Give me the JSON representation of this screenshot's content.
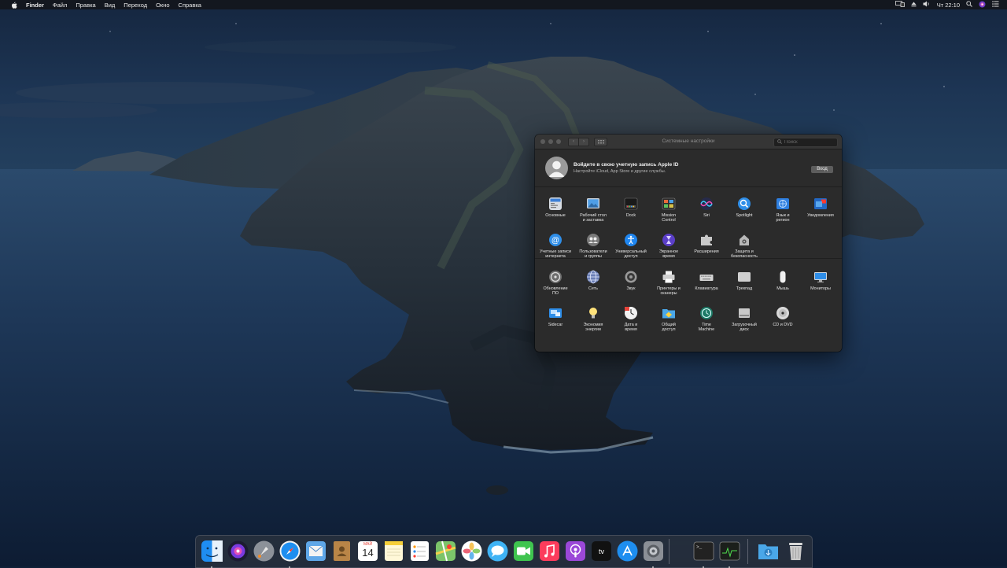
{
  "menubar": {
    "app": "Finder",
    "items": [
      "Файл",
      "Правка",
      "Вид",
      "Переход",
      "Окно",
      "Справка"
    ],
    "clock": "Чт 22:10"
  },
  "window": {
    "title": "Системные настройки",
    "search_placeholder": "Поиск",
    "apple_id": {
      "heading": "Войдите в свою учетную запись Apple ID",
      "subtitle": "Настройте iCloud, App Store и другие службы.",
      "button": "Вход"
    },
    "section1": [
      {
        "label": "Основные",
        "icon": "general-icon"
      },
      {
        "label": "Рабочий стол\nи заставка",
        "icon": "desktop-screensaver-icon"
      },
      {
        "label": "Dock",
        "icon": "dock-icon"
      },
      {
        "label": "Mission\nControl",
        "icon": "mission-control-icon"
      },
      {
        "label": "Siri",
        "icon": "siri-icon"
      },
      {
        "label": "Spotlight",
        "icon": "spotlight-icon"
      },
      {
        "label": "Язык и\nрегион",
        "icon": "language-region-icon"
      },
      {
        "label": "Уведомления",
        "icon": "notifications-icon"
      },
      {
        "label": "Учетные записи\nинтернета",
        "icon": "internet-accounts-icon"
      },
      {
        "label": "Пользователи\nи группы",
        "icon": "users-groups-icon"
      },
      {
        "label": "Универсальный\nдоступ",
        "icon": "accessibility-icon"
      },
      {
        "label": "Экранное\nвремя",
        "icon": "screen-time-icon"
      },
      {
        "label": "Расширения",
        "icon": "extensions-icon"
      },
      {
        "label": "Защита и\nбезопасность",
        "icon": "security-privacy-icon"
      }
    ],
    "section2": [
      {
        "label": "Обновление\nПО",
        "icon": "software-update-icon"
      },
      {
        "label": "Сеть",
        "icon": "network-icon"
      },
      {
        "label": "Звук",
        "icon": "sound-icon"
      },
      {
        "label": "Принтеры и\nсканеры",
        "icon": "printers-scanners-icon"
      },
      {
        "label": "Клавиатура",
        "icon": "keyboard-icon"
      },
      {
        "label": "Трекпад",
        "icon": "trackpad-icon"
      },
      {
        "label": "Мышь",
        "icon": "mouse-icon"
      },
      {
        "label": "Мониторы",
        "icon": "displays-icon"
      },
      {
        "label": "Sidecar",
        "icon": "sidecar-icon"
      },
      {
        "label": "Экономия\nэнергии",
        "icon": "energy-saver-icon"
      },
      {
        "label": "Дата и\nвремя",
        "icon": "date-time-icon"
      },
      {
        "label": "Общий\nдоступ",
        "icon": "sharing-icon"
      },
      {
        "label": "Time\nMachine",
        "icon": "time-machine-icon"
      },
      {
        "label": "Загрузочный\nдиск",
        "icon": "startup-disk-icon"
      },
      {
        "label": "CD и DVD",
        "icon": "cd-dvd-icon"
      }
    ]
  },
  "dock": {
    "calendar_month": "МАЙ",
    "calendar_day": "14",
    "items": [
      "finder-icon",
      "siri-icon",
      "launchpad-icon",
      "safari-icon",
      "mail-icon",
      "contacts-icon",
      "calendar-icon",
      "notes-icon",
      "reminders-icon",
      "maps-icon",
      "photos-icon",
      "messages-icon",
      "facetime-icon",
      "music-icon",
      "podcasts-icon",
      "tv-icon",
      "app-store-icon",
      "system-preferences-icon",
      "terminal-icon",
      "activity-monitor-icon",
      "downloads-folder-icon",
      "trash-icon"
    ]
  }
}
